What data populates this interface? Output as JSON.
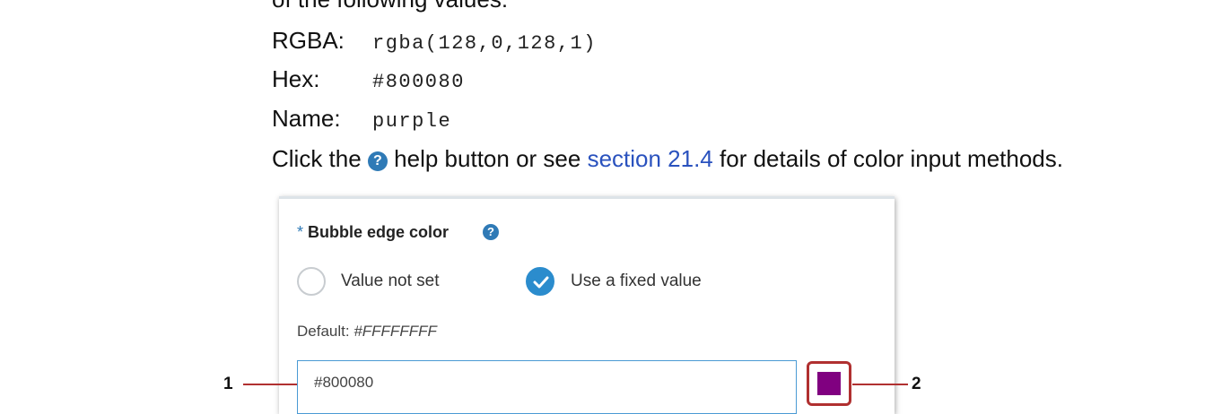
{
  "doc": {
    "intro_fragment": "of the following values:",
    "rgba_label": "RGBA:",
    "rgba_value": "rgba(128,0,128,1)",
    "hex_label": "Hex:",
    "hex_value": "#800080",
    "name_label": "Name:",
    "name_value": "purple",
    "click_prefix": "Click the",
    "click_middle": "help button or see",
    "section_link": "section 21.4",
    "click_suffix": "for details of color input methods."
  },
  "panel": {
    "required_marker": "*",
    "title": "Bubble edge color",
    "help_icon": "question-circle-icon",
    "options": [
      {
        "label": "Value not set",
        "checked": false
      },
      {
        "label": "Use a fixed value",
        "checked": true
      }
    ],
    "default_prefix": "Default:",
    "default_value": "#FFFFFFFF",
    "input_value": "#800080",
    "swatch_color": "#800080"
  },
  "callouts": {
    "left": "1",
    "right": "2"
  },
  "colors": {
    "accent": "#2f7ab6",
    "highlight": "#b03030",
    "link": "#2a52be"
  }
}
